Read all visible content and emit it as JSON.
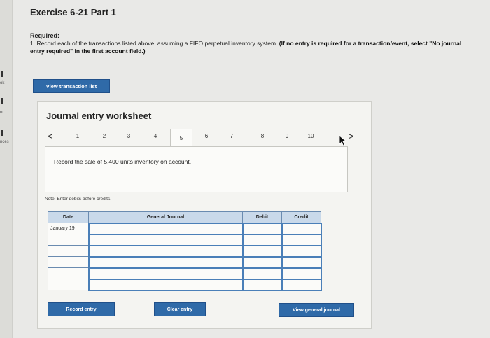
{
  "sidebar": {
    "marks": [
      "ok",
      "nt",
      "nces"
    ]
  },
  "header": {
    "title": "Exercise 6-21 Part 1",
    "required_label": "Required:",
    "instruction_plain": "1. Record each of the transactions listed above, assuming a FIFO perpetual inventory system. ",
    "instruction_bold": "(If no entry is required for a transaction/event, select \"No journal entry required\" in the first account field.)"
  },
  "buttons": {
    "view_transaction_list": "View transaction list",
    "record_entry": "Record entry",
    "clear_entry": "Clear entry",
    "view_general_journal": "View general journal"
  },
  "worksheet": {
    "title": "Journal entry worksheet",
    "pager": {
      "prev": "<",
      "next": ">",
      "pages": [
        "1",
        "2",
        "3",
        "4",
        "5",
        "6",
        "7",
        "8",
        "9",
        "10"
      ],
      "active_page": "5"
    },
    "description": "Record the sale of 5,400 units inventory on account.",
    "note": "Note: Enter debits before credits.",
    "table": {
      "headers": {
        "date": "Date",
        "account": "General Journal",
        "debit": "Debit",
        "credit": "Credit"
      },
      "rows": [
        {
          "date": "January 19"
        },
        {
          "date": ""
        },
        {
          "date": ""
        },
        {
          "date": ""
        },
        {
          "date": ""
        },
        {
          "date": ""
        }
      ]
    }
  },
  "colors": {
    "accent": "#2f6aa8",
    "table_header": "#c9d9ea",
    "background": "#e9e9e7"
  }
}
